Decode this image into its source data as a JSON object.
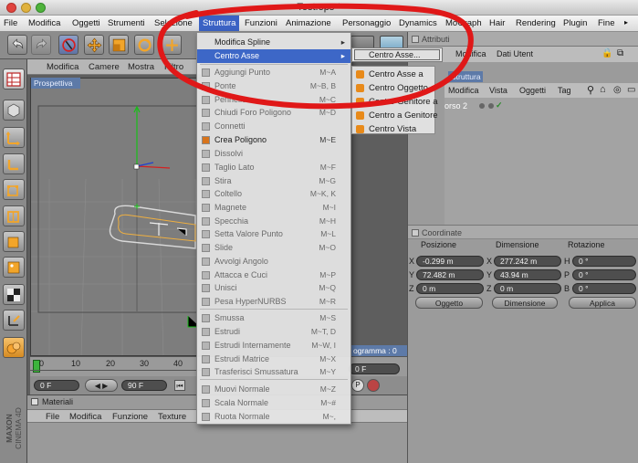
{
  "window": {
    "title": "Test.eps *"
  },
  "menubar": {
    "items": [
      "File",
      "Modifica",
      "Oggetti",
      "Strumenti",
      "Selezione",
      "Struttura",
      "Funzioni",
      "Animazione",
      "Personaggio",
      "Dynamics",
      "MoGraph",
      "Hair",
      "Rendering",
      "Plugin",
      "Fine"
    ],
    "active": "Struttura"
  },
  "viewport": {
    "menu": [
      "Modifica",
      "Camere",
      "Mostra",
      "Filtro"
    ],
    "label": "Prospettiva"
  },
  "timeline": {
    "ticks": [
      "0",
      "10",
      "20",
      "30",
      "40"
    ],
    "current": "0 F",
    "end": "90 F",
    "right_value": "0 F",
    "status": "ogramma : 0"
  },
  "materials": {
    "title": "Materiali",
    "menu": [
      "File",
      "Modifica",
      "Funzione",
      "Texture"
    ]
  },
  "logo": {
    "brand": "MAXON",
    "product": "CINEMA 4D"
  },
  "attributes": {
    "title": "Attributi",
    "tab": "Dati Utent",
    "menu_partial": "Modifica"
  },
  "objects": {
    "tab": "Struttura",
    "menu": [
      "Modifica",
      "Vista",
      "Oggetti",
      "Tag"
    ],
    "item": "orso 2"
  },
  "coordinates": {
    "title": "Coordinate",
    "headers": [
      "Posizione",
      "Dimensione",
      "Rotazione"
    ],
    "rows": [
      {
        "axis": "X",
        "pos": "-0.299 m",
        "dim_axis": "X",
        "dim": "277.242 m",
        "rot_axis": "H",
        "rot": "0 °"
      },
      {
        "axis": "Y",
        "pos": "72.482 m",
        "dim_axis": "Y",
        "dim": "43.94 m",
        "rot_axis": "P",
        "rot": "0 °"
      },
      {
        "axis": "Z",
        "pos": "0 m",
        "dim_axis": "Z",
        "dim": "0 m",
        "rot_axis": "B",
        "rot": "0 °"
      }
    ],
    "mode": "Oggetto",
    "dim_mode": "Dimensione",
    "apply": "Applica"
  },
  "dropdown": {
    "items": [
      {
        "label": "Modifica Spline",
        "shortcut": "",
        "arrow": true,
        "style": "normal"
      },
      {
        "label": "Centro Asse",
        "shortcut": "",
        "arrow": true,
        "style": "highlight"
      },
      {
        "label": "Aggiungi Punto",
        "shortcut": "M~A",
        "style": "dim"
      },
      {
        "label": "Ponte",
        "shortcut": "M~B, B",
        "style": "dim"
      },
      {
        "label": "Pennello",
        "shortcut": "M~C",
        "style": "dim"
      },
      {
        "label": "Chiudi Foro Poligono",
        "shortcut": "M~D",
        "style": "dim"
      },
      {
        "label": "Connetti",
        "shortcut": "",
        "style": "dim"
      },
      {
        "label": "Crea Poligono",
        "shortcut": "M~E",
        "style": "normal"
      },
      {
        "label": "Dissolvi",
        "shortcut": "",
        "style": "dim"
      },
      {
        "label": "Taglio Lato",
        "shortcut": "M~F",
        "style": "dim"
      },
      {
        "label": "Stira",
        "shortcut": "M~G",
        "style": "dim"
      },
      {
        "label": "Coltello",
        "shortcut": "M~K, K",
        "style": "dim"
      },
      {
        "label": "Magnete",
        "shortcut": "M~I",
        "style": "dim"
      },
      {
        "label": "Specchia",
        "shortcut": "M~H",
        "style": "dim"
      },
      {
        "label": "Setta Valore Punto",
        "shortcut": "M~L",
        "style": "dim"
      },
      {
        "label": "Slide",
        "shortcut": "M~O",
        "style": "dim"
      },
      {
        "label": "Avvolgi Angolo",
        "shortcut": "",
        "style": "dim"
      },
      {
        "label": "Attacca e Cuci",
        "shortcut": "M~P",
        "style": "dim"
      },
      {
        "label": "Unisci",
        "shortcut": "M~Q",
        "style": "dim"
      },
      {
        "label": "Pesa HyperNURBS",
        "shortcut": "M~R",
        "style": "dim"
      },
      {
        "label": "Smussa",
        "shortcut": "M~S",
        "style": "dim"
      },
      {
        "label": "Estrudi",
        "shortcut": "M~T, D",
        "style": "dim"
      },
      {
        "label": "Estrudi Internamente",
        "shortcut": "M~W, I",
        "style": "dim"
      },
      {
        "label": "Estrudi Matrice",
        "shortcut": "M~X",
        "style": "dim"
      },
      {
        "label": "Trasferisci Smussatura",
        "shortcut": "M~Y",
        "style": "dim"
      },
      {
        "label": "Muovi Normale",
        "shortcut": "M~Z",
        "style": "dim"
      },
      {
        "label": "Scala Normale",
        "shortcut": "M~#",
        "style": "dim"
      },
      {
        "label": "Ruota Normale",
        "shortcut": "M~,",
        "style": "dim"
      }
    ]
  },
  "submenu": {
    "selected": "Centro Asse...",
    "items": [
      "Centro Asse a",
      "Centro Oggetto a",
      "Centro Genitore a",
      "Centro a Genitore",
      "Centro Vista"
    ]
  },
  "colors": {
    "highlight": "#3d67c7",
    "annotation": "#e01818",
    "tab_blue": "#5d7aa8",
    "field_dark": "#4e4e4e"
  }
}
